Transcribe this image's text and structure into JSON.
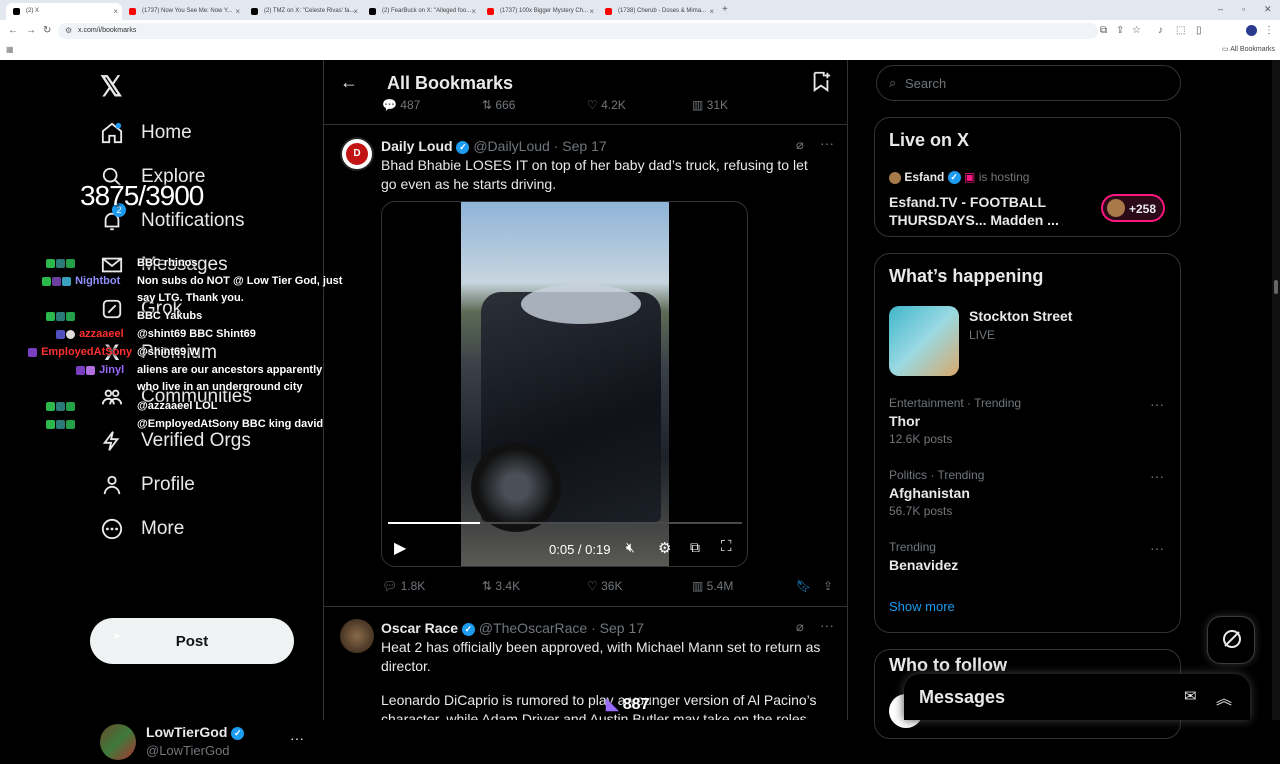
{
  "browser": {
    "tabs": [
      {
        "title": "(2) X",
        "color": "#000000",
        "active": true
      },
      {
        "title": "(1737) Now You See Me: Now Y...",
        "color": "#ff0000"
      },
      {
        "title": "(2) TMZ on X: \"Celeste Rivas' fa...",
        "color": "#000000"
      },
      {
        "title": "(2) FearBuck on X: \"Alleged foo...",
        "color": "#000000"
      },
      {
        "title": "(1737) 100x Bigger Mystery Ch...",
        "color": "#ff0000"
      },
      {
        "title": "(1738) Cherub - Doses & Mima...",
        "color": "#ff0000"
      }
    ],
    "new_tab": "+",
    "url": "x.com/i/bookmarks",
    "bookmarks_folder": "All Bookmarks"
  },
  "sidebar": {
    "logo": "𝕏",
    "items": [
      {
        "label": "Home",
        "icon": "home-icon"
      },
      {
        "label": "Explore",
        "icon": "search-icon"
      },
      {
        "label": "Notifications",
        "icon": "bell-icon",
        "badge": "2"
      },
      {
        "label": "Messages",
        "icon": "mail-icon"
      },
      {
        "label": "Grok",
        "icon": "grok-icon"
      },
      {
        "label": "Premium",
        "icon": "x-logo-icon"
      },
      {
        "label": "Communities",
        "icon": "people-icon"
      },
      {
        "label": "Verified Orgs",
        "icon": "bolt-icon"
      },
      {
        "label": "Profile",
        "icon": "person-icon"
      },
      {
        "label": "More",
        "icon": "more-circle-icon"
      }
    ],
    "post_label": "Post",
    "account": {
      "name": "LowTierGod",
      "handle": "@LowTierGod"
    }
  },
  "overlay": {
    "counter": "3875/3900",
    "chat": [
      {
        "user": "",
        "msg": "BBC rhinos",
        "ucolor": "#7a1fd1"
      },
      {
        "user": "Nightbot",
        "msg": "Non subs do NOT @ Low Tier God, just",
        "ucolor": "#8e8efc"
      },
      {
        "user": "",
        "msg": "say LTG. Thank you.",
        "ucolor": "#ffffff"
      },
      {
        "user": "",
        "msg": "BBC Yakubs",
        "ucolor": "#7a1fd1"
      },
      {
        "user": "azzaaeel",
        "msg": "@shint69 BBC Shint69",
        "ucolor": "#ff3030"
      },
      {
        "user": "EmployedAtSony",
        "msg": "@shint69 W",
        "ucolor": "#ff3030"
      },
      {
        "user": "Jinyl",
        "msg": "aliens are our ancestors apparently",
        "ucolor": "#9a6bff"
      },
      {
        "user": "",
        "msg": "who live in an underground city",
        "ucolor": "#ffffff"
      },
      {
        "user": "",
        "msg": "@azzaaeel LOL",
        "ucolor": "#7a1fd1"
      },
      {
        "user": "",
        "msg": "@EmployedAtSony BBC king david",
        "ucolor": "#7a1fd1"
      }
    ],
    "bottom_count": "887"
  },
  "main": {
    "header_title": "All Bookmarks",
    "prev_actions": {
      "replies": "487",
      "reposts": "666",
      "likes": "4.2K",
      "views": "31K"
    },
    "tweet1": {
      "name": "Daily Loud",
      "handle": "@DailyLoud",
      "date": "· Sep 17",
      "text": "Bhad Bhabie LOSES IT on top of her baby dad’s truck, refusing to let go even as he starts driving.",
      "video_time": "0:05 / 0:19",
      "replies": "1.8K",
      "reposts": "3.4K",
      "likes": "36K",
      "views": "5.4M"
    },
    "tweet2": {
      "name": "Oscar Race",
      "handle": "@TheOscarRace",
      "date": "· Sep 17",
      "text1": "Heat 2 has officially been approved, with Michael Mann set to return as director.",
      "text2": "Leonardo DiCaprio is rumored to play a younger version of Al Pacino’s character, while Adam Driver and Austin Butler may take on the roles first"
    }
  },
  "right": {
    "search_placeholder": "Search",
    "live": {
      "title": "Live on X",
      "host": "Esfand",
      "hosting": "is hosting",
      "show": "Esfand.TV - FOOTBALL THURSDAYS... Madden ...",
      "listeners": "+258"
    },
    "happening": {
      "title": "What’s happening",
      "event": {
        "name": "Stockton Street",
        "status": "LIVE"
      },
      "trends": [
        {
          "meta": "Entertainment · Trending",
          "name": "Thor",
          "posts": "12.6K posts"
        },
        {
          "meta": "Politics · Trending",
          "name": "Afghanistan",
          "posts": "56.7K posts"
        },
        {
          "meta": "Trending",
          "name": "Benavidez",
          "posts": ""
        }
      ],
      "show_more": "Show more"
    },
    "who_to_follow": "Who to follow",
    "messages_drawer": "Messages"
  },
  "colors": {
    "accent": "#1d9bf0",
    "bookmark": "#1d9bf0",
    "live": "#f91880"
  }
}
